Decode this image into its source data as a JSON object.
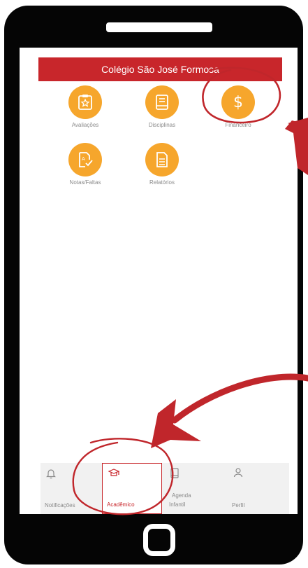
{
  "app": {
    "title": "Colégio São José Formosa"
  },
  "menu": {
    "items": [
      {
        "label": "Avaliações",
        "icon": "clipboard-star-icon"
      },
      {
        "label": "Disciplinas",
        "icon": "book-icon"
      },
      {
        "label": "Financeiro",
        "icon": "dollar-icon"
      },
      {
        "label": "Notas/Faltas",
        "icon": "graded-document-icon"
      },
      {
        "label": "Relatórios",
        "icon": "report-icon"
      }
    ]
  },
  "bottom_nav": {
    "items": [
      {
        "label": "Notificações",
        "icon": "bell-icon",
        "active": false
      },
      {
        "label": "Acadêmico",
        "icon": "graduation-cap-icon",
        "active": true
      },
      {
        "label": "Agenda",
        "label2": "Infantil",
        "icon": "notebook-icon",
        "active": false
      },
      {
        "label": "Perfil",
        "icon": "user-icon",
        "active": false
      }
    ]
  },
  "colors": {
    "brand_red": "#c8262b",
    "tile_orange": "#f6a62c",
    "annotation_red": "#c0262b",
    "phone_frame": "#050505"
  }
}
